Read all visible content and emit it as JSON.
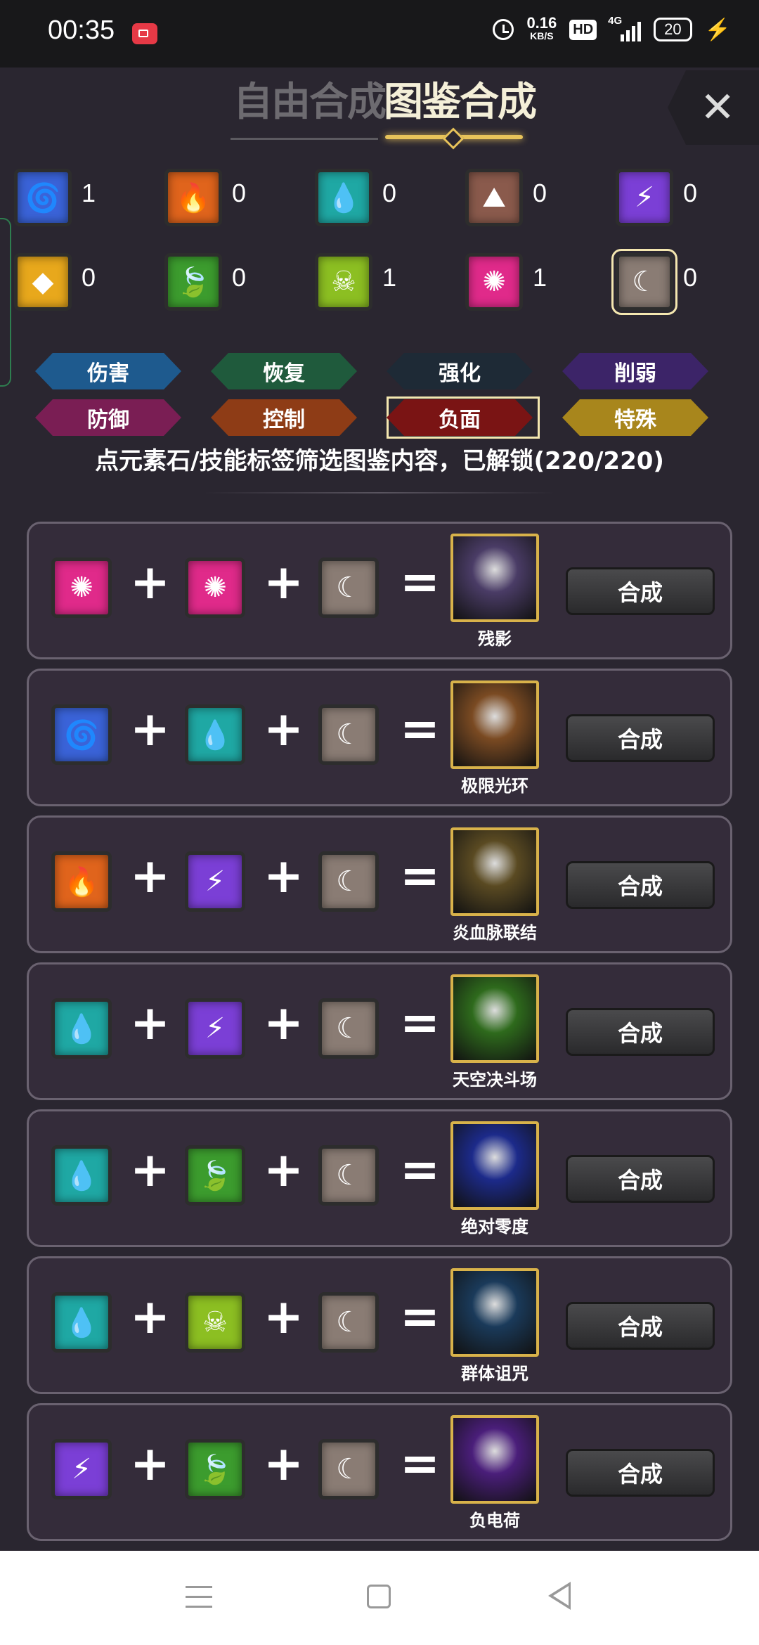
{
  "status_bar": {
    "time": "00:35",
    "speed_value": "0.16",
    "speed_unit": "KB/S",
    "hd": "HD",
    "network": "4G",
    "battery": "20"
  },
  "header": {
    "tab_free": "自由合成",
    "tab_book": "图鉴合成",
    "close": "✕"
  },
  "elements": [
    {
      "icon": "tornado-icon",
      "glyph": "🌀",
      "color": "#3a63d8",
      "count": "1"
    },
    {
      "icon": "fire-icon",
      "glyph": "🔥",
      "color": "#e0641c",
      "count": "0"
    },
    {
      "icon": "water-drop-icon",
      "glyph": "💧",
      "color": "#1fa8a4",
      "count": "0"
    },
    {
      "icon": "rock-icon",
      "glyph": "⛰",
      "color": "#8a5a4c",
      "count": "0"
    },
    {
      "icon": "lightning-icon",
      "glyph": "⚡",
      "color": "#7b3fd6",
      "count": "0"
    },
    {
      "icon": "cube-icon",
      "glyph": "◆",
      "color": "#e8a81c",
      "count": "0"
    },
    {
      "icon": "leaf-icon",
      "glyph": "🍃",
      "color": "#3c9c2e",
      "count": "0"
    },
    {
      "icon": "skull-icon",
      "glyph": "☠",
      "color": "#8cbf22",
      "count": "1"
    },
    {
      "icon": "light-orb-icon",
      "glyph": "✺",
      "color": "#e02a8a",
      "count": "1"
    },
    {
      "icon": "moon-icon",
      "glyph": "☾",
      "color": "#8a7c74",
      "count": "0"
    }
  ],
  "filter_tags": [
    {
      "label": "伤害",
      "color": "#1e5a8e"
    },
    {
      "label": "恢复",
      "color": "#1f5a3c"
    },
    {
      "label": "强化",
      "color": "#1e2a36"
    },
    {
      "label": "削弱",
      "color": "#3c2468"
    },
    {
      "label": "防御",
      "color": "#7a1e54"
    },
    {
      "label": "控制",
      "color": "#8e3c16"
    },
    {
      "label": "负面",
      "color": "#7a1414"
    },
    {
      "label": "特殊",
      "color": "#a8861c"
    }
  ],
  "hint": "点元素石/技能标签筛选图鉴内容，已解锁(220/220)",
  "recipes": [
    {
      "ingredients": [
        "light-orb",
        "light-orb",
        "moon"
      ],
      "result": "残影",
      "result_color": "#4a3c66",
      "button": "合成"
    },
    {
      "ingredients": [
        "tornado",
        "water-drop",
        "moon"
      ],
      "result": "极限光环",
      "result_color": "#7a4a22",
      "button": "合成"
    },
    {
      "ingredients": [
        "fire",
        "lightning",
        "moon"
      ],
      "result": "炎血脉联结",
      "result_color": "#5a4a22",
      "button": "合成"
    },
    {
      "ingredients": [
        "water-drop",
        "lightning",
        "moon"
      ],
      "result": "天空决斗场",
      "result_color": "#2e6a1c",
      "button": "合成"
    },
    {
      "ingredients": [
        "water-drop",
        "leaf",
        "moon"
      ],
      "result": "绝对零度",
      "result_color": "#1c2a8a",
      "button": "合成"
    },
    {
      "ingredients": [
        "water-drop",
        "skull",
        "moon"
      ],
      "result": "群体诅咒",
      "result_color": "#1a3a5a",
      "button": "合成"
    },
    {
      "ingredients": [
        "lightning",
        "leaf",
        "moon"
      ],
      "result": "负电荷",
      "result_color": "#4a1e7a",
      "button": "合成"
    }
  ]
}
